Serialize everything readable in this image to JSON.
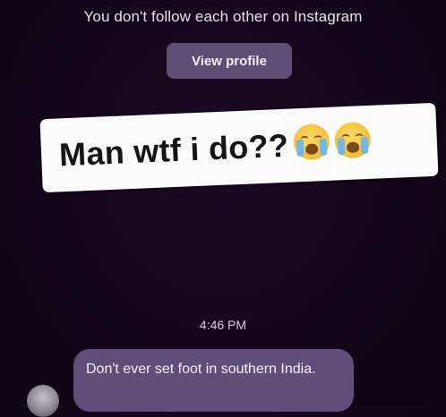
{
  "conversation": {
    "follow_notice": "You don't follow each other on Instagram",
    "view_profile_label": "View profile",
    "timestamp": "4:46 PM"
  },
  "caption_sticker": {
    "text": "Man wtf i do??",
    "emojis": [
      "loudly-crying-face-icon",
      "loudly-crying-face-icon"
    ]
  },
  "messages": [
    {
      "sender": "other",
      "text": "Don't ever set foot in southern India.",
      "bubble_color": "#614d7a"
    }
  ],
  "colors": {
    "background": "#140619",
    "button": "#5e4d75",
    "sticker": "#fbfbfb"
  }
}
